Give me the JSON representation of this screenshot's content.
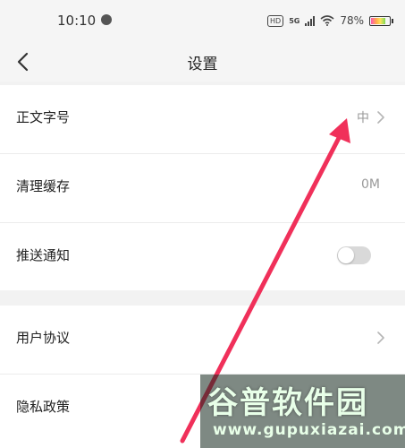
{
  "status_bar": {
    "time": "10:10",
    "hd": "HD",
    "network": "5G",
    "battery_percent": "78%"
  },
  "navbar": {
    "title": "设置"
  },
  "settings": {
    "font_size": {
      "label": "正文字号",
      "value": "中"
    },
    "clear_cache": {
      "label": "清理缓存",
      "value": "0M"
    },
    "push_notification": {
      "label": "推送通知",
      "enabled": false
    },
    "user_agreement": {
      "label": "用户协议"
    },
    "privacy_policy": {
      "label": "隐私政策"
    }
  },
  "annotation": {
    "arrow_color": "#f0305a"
  },
  "watermark": {
    "logo": "谷普软件园",
    "url": "www.gupuxiazai.com"
  }
}
